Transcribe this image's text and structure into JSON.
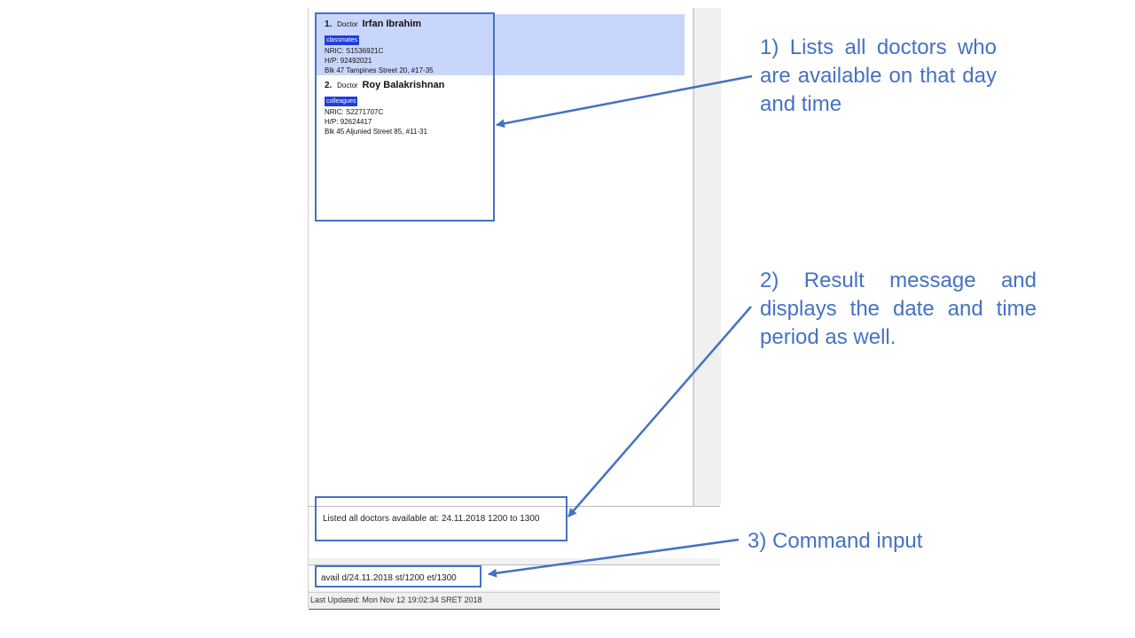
{
  "list": {
    "items": [
      {
        "index": "1.",
        "role": "Doctor",
        "name": "Irfan Ibrahim",
        "tag": "classmates",
        "nric": "NRIC: S1536921C",
        "phone": "H/P: 92492021",
        "address": "Blk 47 Tampines Street 20, #17-35",
        "selected": true
      },
      {
        "index": "2.",
        "role": "Doctor",
        "name": "Roy Balakrishnan",
        "tag": "colleagues",
        "nric": "NRIC: S2271707C",
        "phone": "H/P: 92624417",
        "address": "Blk 45 Aljunied Street 85, #11-31",
        "selected": false
      }
    ]
  },
  "result": {
    "message": "Listed all doctors available at: 24.11.2018 1200 to 1300"
  },
  "command": {
    "value": "avail d/24.11.2018 st/1200 et/1300"
  },
  "status": {
    "text": "Last Updated: Mon Nov 12 19:02:34 SRET 2018"
  },
  "annotations": {
    "a1": "1) Lists all doctors who are available on that day and time",
    "a2": "2) Result message and displays the date and time period as well.",
    "a3": "3) Command input"
  },
  "colors": {
    "annotation": "#4472c4",
    "selected_card": "#c9d6fb",
    "tag": "#1e3ee0"
  }
}
